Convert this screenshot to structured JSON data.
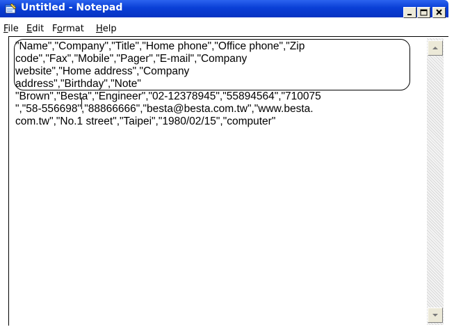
{
  "window": {
    "title": "Untitled - Notepad",
    "buttons": {
      "minimize": "minimize",
      "maximize": "maximize",
      "close": "close"
    },
    "colors": {
      "titlebar": "#0a3fd6",
      "title_text": "#ffffff"
    }
  },
  "menu": {
    "items": [
      {
        "label_rest": "ile",
        "access": "F"
      },
      {
        "label_rest": "dit",
        "access": "E"
      },
      {
        "label_pre": "F",
        "access": "o",
        "label_rest": "rmat"
      },
      {
        "label_rest": "elp",
        "access": "H"
      }
    ]
  },
  "editor": {
    "lines": [
      "\"Name\",\"Company\",\"Title\",\"Home phone\",\"Office phone\",\"Zip",
      "code\",\"Fax\",\"Mobile\",\"Pager\",\"E-mail\",\"Company",
      "website\",\"Home address\",\"Company",
      "address\",\"Birthday\",\"Note\"",
      "\"Brown\",\"Besta\",\"Engineer\",\"02-12378945\",\"55894564\",\"710075",
      "\",\"58-556698\",\"88866666\",\"besta@besta.com.tw\",\"www.besta.",
      "com.tw\",\"No.1 street\",\"Taipei\",\"1980/02/15\",\"computer\""
    ]
  },
  "icons": {
    "app": "notepad-icon",
    "scroll_up": "scroll-up-arrow-icon",
    "scroll_down": "scroll-down-arrow-icon"
  }
}
